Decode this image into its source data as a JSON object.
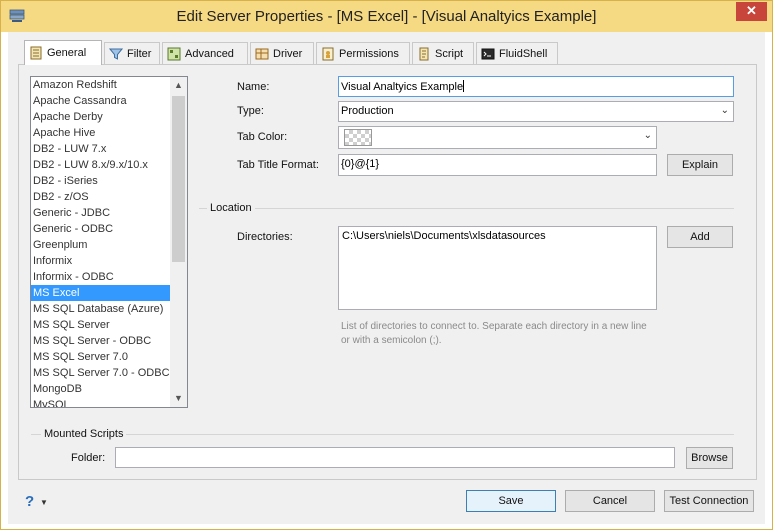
{
  "window": {
    "title": "Edit Server Properties - [MS Excel] - [Visual Analtyics Example]",
    "close_glyph": "✕"
  },
  "tabs": [
    {
      "label": "General",
      "icon": "general-icon",
      "active": true
    },
    {
      "label": "Filter",
      "icon": "filter-icon"
    },
    {
      "label": "Advanced",
      "icon": "advanced-icon"
    },
    {
      "label": "Driver",
      "icon": "driver-icon"
    },
    {
      "label": "Permissions",
      "icon": "permissions-icon"
    },
    {
      "label": "Script",
      "icon": "script-icon"
    },
    {
      "label": "FluidShell",
      "icon": "fluidshell-icon"
    }
  ],
  "server_types": [
    "Amazon Redshift",
    "Apache Cassandra",
    "Apache Derby",
    "Apache Hive",
    "DB2 - LUW 7.x",
    "DB2 - LUW 8.x/9.x/10.x",
    "DB2 - iSeries",
    "DB2 - z/OS",
    "Generic - JDBC",
    "Generic - ODBC",
    "Greenplum",
    "Informix",
    "Informix - ODBC",
    "MS Excel",
    "MS SQL Database (Azure)",
    "MS SQL Server",
    "MS SQL Server - ODBC",
    "MS SQL Server 7.0",
    "MS SQL Server 7.0 - ODBC",
    "MongoDB",
    "MySQL"
  ],
  "selected_server_type": "MS Excel",
  "form": {
    "name_label": "Name:",
    "name_value": "Visual Analtyics Example",
    "type_label": "Type:",
    "type_value": "Production",
    "tab_color_label": "Tab Color:",
    "tab_title_format_label": "Tab Title Format:",
    "tab_title_format_value": "{0}@{1}",
    "explain_button": "Explain"
  },
  "location": {
    "group_title": "Location",
    "directories_label": "Directories:",
    "directories_value": "C:\\Users\\niels\\Documents\\xlsdatasources",
    "add_button": "Add",
    "hint_line1": "List of directories to connect to. Separate each directory in a new line",
    "hint_line2": "or with a semicolon (;)."
  },
  "mounted_scripts": {
    "group_title": "Mounted Scripts",
    "folder_label": "Folder:",
    "folder_value": "",
    "browse_button": "Browse"
  },
  "footer": {
    "help_glyph": "?",
    "save_button": "Save",
    "cancel_button": "Cancel",
    "test_button": "Test Connection"
  },
  "colors": {
    "titlebar": "#f6d983",
    "selection": "#3399ff",
    "close": "#c7453a"
  }
}
